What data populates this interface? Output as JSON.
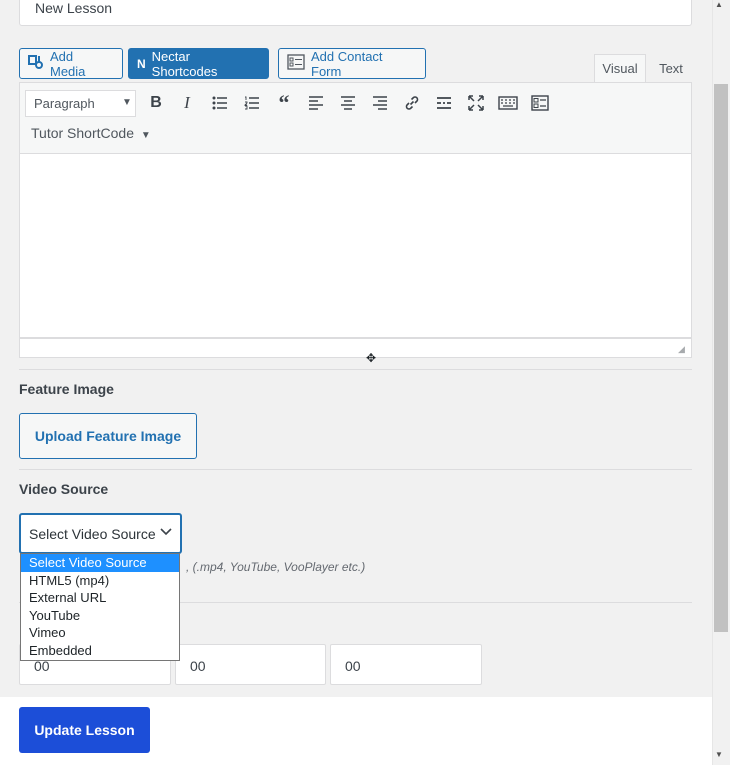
{
  "title_field": {
    "value": "New Lesson"
  },
  "media_buttons": {
    "add_media": "Add Media",
    "nectar": "Nectar Shortcodes",
    "contact_form": "Add Contact Form"
  },
  "editor_tabs": {
    "visual": "Visual",
    "text": "Text"
  },
  "toolbar": {
    "format_select": "Paragraph",
    "shortcode": "Tutor ShortCode",
    "buttons": [
      "bold-icon",
      "italic-icon",
      "bullet-list-icon",
      "numbered-list-icon",
      "blockquote-icon",
      "align-left-icon",
      "align-center-icon",
      "align-right-icon",
      "link-icon",
      "read-more-icon",
      "fullscreen-icon",
      "keyboard-icon",
      "toolbar-toggle-icon"
    ]
  },
  "feature_image": {
    "label": "Feature Image",
    "button": "Upload Feature Image"
  },
  "video": {
    "label": "Video Source",
    "selected": "Select Video Source",
    "hint": ", (.mp4, YouTube, VooPlayer etc.)",
    "options": [
      "Select Video Source",
      "HTML5 (mp4)",
      "External URL",
      "YouTube",
      "Vimeo",
      "Embedded"
    ]
  },
  "playback_time": {
    "hours": "00",
    "minutes": "00",
    "seconds": "00"
  },
  "footer": {
    "update_button": "Update Lesson"
  },
  "colors": {
    "accent": "#2271b1",
    "primary_button": "#1c4ed8",
    "option_highlight": "#1e90ff"
  }
}
